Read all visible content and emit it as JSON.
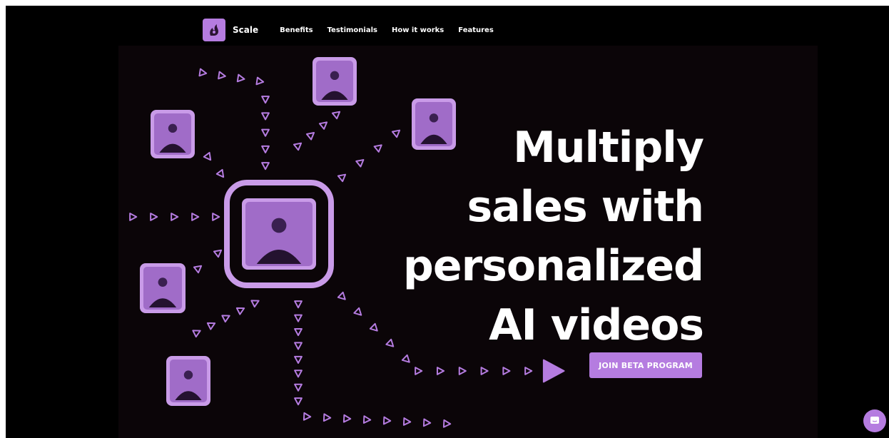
{
  "colors": {
    "accent": "#b57ce0",
    "accent_light": "#c99be8",
    "background": "#000000",
    "hero_bg": "#0b0508",
    "text": "#ffffff"
  },
  "nav": {
    "brand": "Scale",
    "logo_icon": "flame-head-logo-icon",
    "links": [
      "Benefits",
      "Testimonials",
      "How it works",
      "Features"
    ]
  },
  "hero": {
    "headline_lines": [
      "Multiply",
      "sales with",
      "personalized",
      "AI videos"
    ],
    "cta_label": "JOIN BETA PROGRAM"
  },
  "decor": {
    "video_thumbnail_icon": "presenter-video-icon",
    "arrow_icon": "play-arrow-icon",
    "chat_icon": "chat-bubble-icon"
  }
}
